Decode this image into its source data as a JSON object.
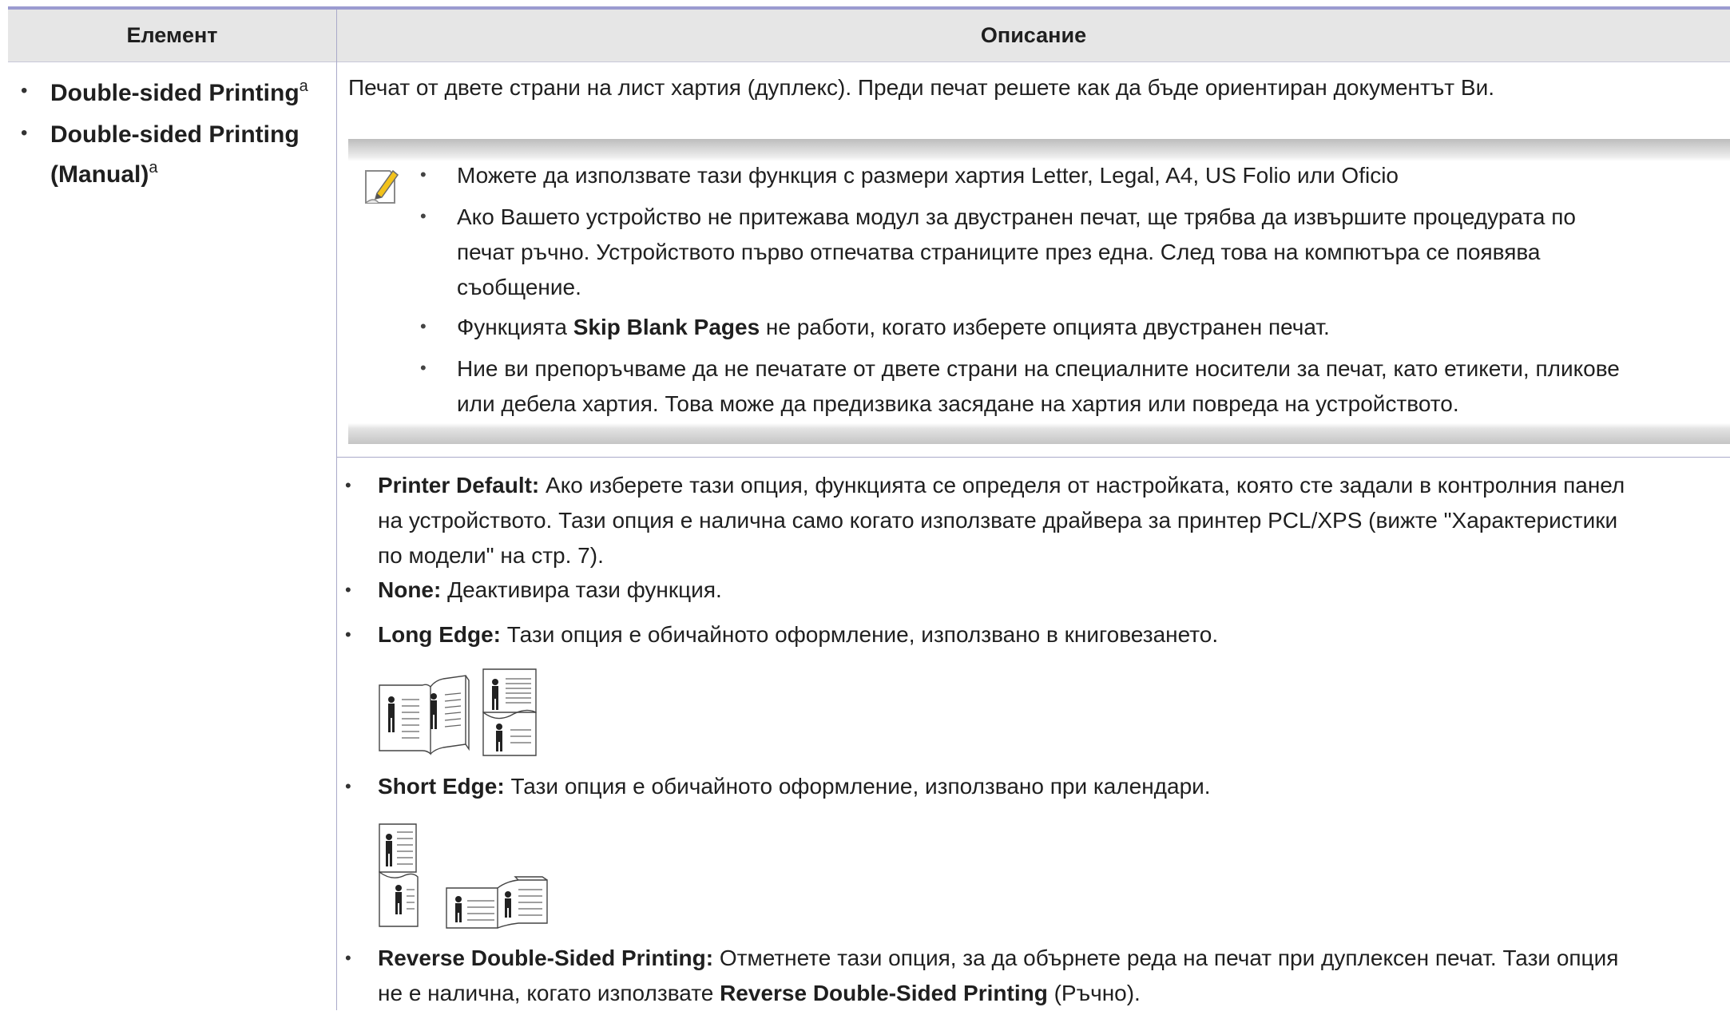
{
  "table": {
    "header": {
      "element": "Елемент",
      "description": "Описание"
    },
    "element_items": [
      {
        "label": "Double-sided Printing",
        "sup": "a"
      },
      {
        "label_line1": "Double-sided Printing",
        "label_line2": "(Manual)",
        "sup": "a"
      }
    ],
    "intro": "Печат от двете страни на лист хартия (дуплекс). Преди печат решете как да бъде ориентиран документът Ви.",
    "note": {
      "icon": "note-pencil-icon",
      "items": [
        {
          "line1": "Можете да използвате тази функция с размери хартия Letter, Legal, A4, US Folio или Oficio"
        },
        {
          "line1": "Ако Вашето устройство не притежава модул за двустранен печат, ще трябва да извършите процедурата по",
          "line2": "печат ръчно. Устройството първо отпечатва страниците през една. След това на компютъра се появява",
          "line3": "съобщение."
        },
        {
          "before": "Функцията ",
          "bold": "Skip Blank Pages",
          "after": " не работи, когато изберете опцията двустранен печат."
        },
        {
          "line1": "Ние ви препоръчваме да не печатате от двете страни на специалните носители за печат, като етикети, пликове",
          "line2": "или дебела хартия. Това може да предизвика засядане на хартия или повреда на устройството."
        }
      ]
    },
    "options": [
      {
        "bold": "Printer Default:",
        "line1": " Ако изберете тази опция, функцията се определя от настройката, която сте задали в контролния панел",
        "line2": "на устройството. Тази опция е налична само когато използвате драйвера за принтер PCL/XPS (вижте \"Характеристики",
        "line3": "по модели\" на стр. 7)."
      },
      {
        "bold": "None:",
        "text": " Деактивира тази функция."
      },
      {
        "bold": "Long Edge:",
        "text": " Тази опция е обичайното оформление, използвано в книговезането.",
        "illustration": "long-edge-binding-icon"
      },
      {
        "bold": "Short Edge:",
        "text": " Тази опция е обичайното оформление, използвано при календари.",
        "illustration": "short-edge-binding-icon"
      },
      {
        "bold": "Reverse Double-Sided Printing:",
        "line1": " Отметнете тази опция, за да обърнете реда на печат при дуплексен печат. Тази опция",
        "line2_before": "не е налична, когато използвате ",
        "line2_bold": "Reverse Double-Sided Printing",
        "line2_after": " (Ръчно)."
      }
    ]
  }
}
